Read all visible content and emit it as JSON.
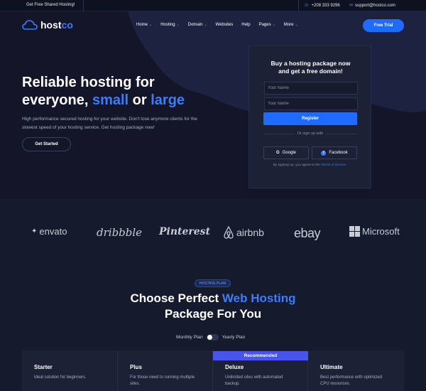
{
  "topbar": {
    "promo": "Get Free Shared Hosting!",
    "phone": "+208 333 9296",
    "email": "support@hostco.com"
  },
  "logo": {
    "brand_main": "host",
    "brand_accent": "co"
  },
  "nav": {
    "items": [
      {
        "label": "Home",
        "dropdown": true
      },
      {
        "label": "Hosting",
        "dropdown": true
      },
      {
        "label": "Domain",
        "dropdown": true
      },
      {
        "label": "Websites",
        "dropdown": false
      },
      {
        "label": "Help",
        "dropdown": false
      },
      {
        "label": "Pages",
        "dropdown": true
      },
      {
        "label": "More",
        "dropdown": true
      }
    ],
    "cta": "Free Trial"
  },
  "hero": {
    "title_line1": "Reliable hosting for",
    "title_line2_a": "everyone, ",
    "title_line2_b": "small",
    "title_line2_c": " or ",
    "title_line2_d": "large",
    "description": "High performance secured hosting for your website. Don't lose anymore clients for the slowest speed of your hosting service. Get hosting package now!",
    "button": "Get Started"
  },
  "signup": {
    "title_line1": "Buy a hosting package now",
    "title_line2": "and get a free domain!",
    "name_placeholder": "Your Name",
    "name2_placeholder": "Your Name",
    "register": "Register",
    "or_text": "Or sign up with",
    "google": "Google",
    "facebook": "Facebook",
    "terms_prefix": "By signing up, you agree to the ",
    "terms_link": "Terms of service."
  },
  "brands": [
    "envato",
    "dribbble",
    "Pinterest",
    "airbnb",
    "ebay",
    "Microsoft"
  ],
  "plans_section": {
    "badge": "HOSTING PLAN",
    "title_a": "Choose Perfect ",
    "title_b": "Web Hosting",
    "title_c": "Package For You",
    "monthly": "Monthly Plan",
    "yearly": "Yearly Plan",
    "recommended": "Recommended",
    "plans": [
      {
        "name": "Starter",
        "desc": "Ideal solution for beginners."
      },
      {
        "name": "Plus",
        "desc": "For those need to running multiple sites."
      },
      {
        "name": "Deluxe",
        "desc": "Unlimited sites with automated backup."
      },
      {
        "name": "Ultimate",
        "desc": "Best performance with optimized CPU resources."
      }
    ]
  },
  "colors": {
    "accent": "#1f6bff",
    "accent_text": "#3d7bff",
    "background": "#151a2c",
    "recommended": "#4756e8"
  }
}
